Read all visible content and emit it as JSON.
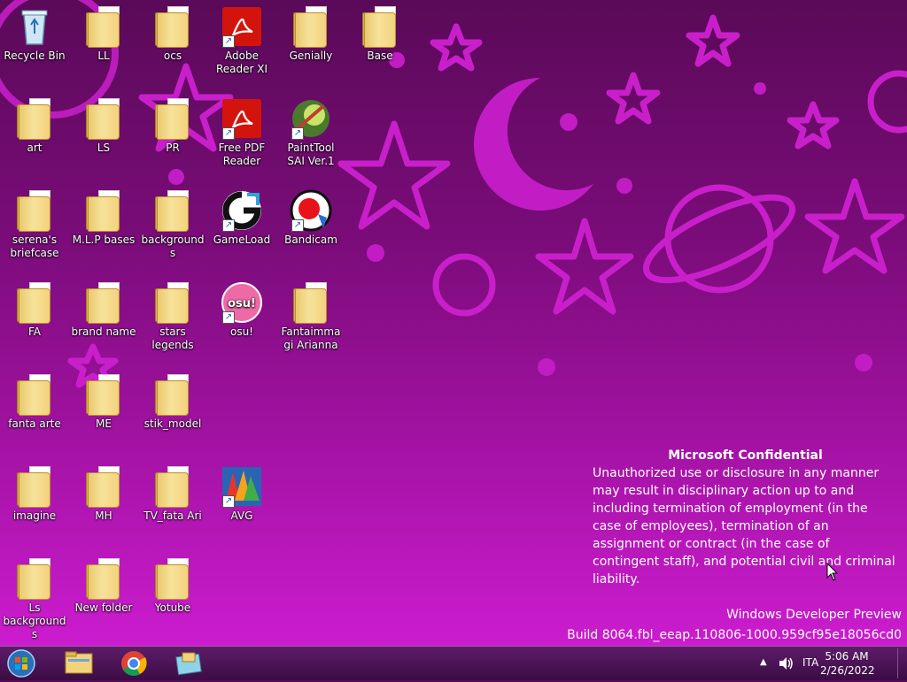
{
  "desktop": {
    "icons": [
      {
        "label": "Recycle Bin",
        "type": "recycle"
      },
      {
        "label": "LL",
        "type": "folder"
      },
      {
        "label": "ocs",
        "type": "folder"
      },
      {
        "label": "Adobe Reader XI",
        "type": "pdf"
      },
      {
        "label": "Genially",
        "type": "folder"
      },
      {
        "label": "Base",
        "type": "folder"
      },
      {
        "label": "art",
        "type": "folder"
      },
      {
        "label": "LS",
        "type": "folder"
      },
      {
        "label": "PR",
        "type": "folder"
      },
      {
        "label": "Free PDF Reader",
        "type": "pdf"
      },
      {
        "label": "PaintTool SAI Ver.1",
        "type": "sai"
      },
      {
        "label": "serena's briefcase",
        "type": "folder"
      },
      {
        "label": "M.L.P bases",
        "type": "folder"
      },
      {
        "label": "backgrounds",
        "type": "folder"
      },
      {
        "label": "GameLoad",
        "type": "gameload"
      },
      {
        "label": "Bandicam",
        "type": "bandicam"
      },
      {
        "label": "FA",
        "type": "folder"
      },
      {
        "label": "brand name",
        "type": "folder"
      },
      {
        "label": "stars legends",
        "type": "folder"
      },
      {
        "label": "osu!",
        "type": "osu"
      },
      {
        "label": "Fantaimmagi Arianna",
        "type": "folder"
      },
      {
        "label": "fanta arte",
        "type": "folder"
      },
      {
        "label": "ME",
        "type": "folder"
      },
      {
        "label": "stik_model",
        "type": "folder"
      },
      {
        "label": "imagine",
        "type": "folder"
      },
      {
        "label": "MH",
        "type": "folder"
      },
      {
        "label": "TV_fata Ari",
        "type": "folder"
      },
      {
        "label": "AVG",
        "type": "avg"
      },
      {
        "label": "Ls backgrounds",
        "type": "folder"
      },
      {
        "label": "New folder",
        "type": "folder"
      },
      {
        "label": "Yotube",
        "type": "folder"
      }
    ]
  },
  "notice": {
    "title": "Microsoft Confidential",
    "body": "Unauthorized use or disclosure in any manner may result in disciplinary action up to and including termination of employment (in the case of employees), termination of an assignment or contract (in the case of contingent staff), and potential civil and criminal liability."
  },
  "build": {
    "line1": "Windows Developer Preview",
    "line2": "Build 8064.fbl_eeap.110806-1000.959cf95e18056cd0"
  },
  "taskbar": {
    "pinned": [
      "start-orb-icon",
      "file-explorer-icon",
      "chrome-icon",
      "control-panel-icon"
    ],
    "tray": {
      "language": "ITA",
      "time": "5:06 AM",
      "date": "2/26/2022"
    }
  },
  "colors": {
    "wallpaper_top": "#5a0a58",
    "wallpaper_bottom": "#d21ed6",
    "stars": "#d21fd4"
  }
}
